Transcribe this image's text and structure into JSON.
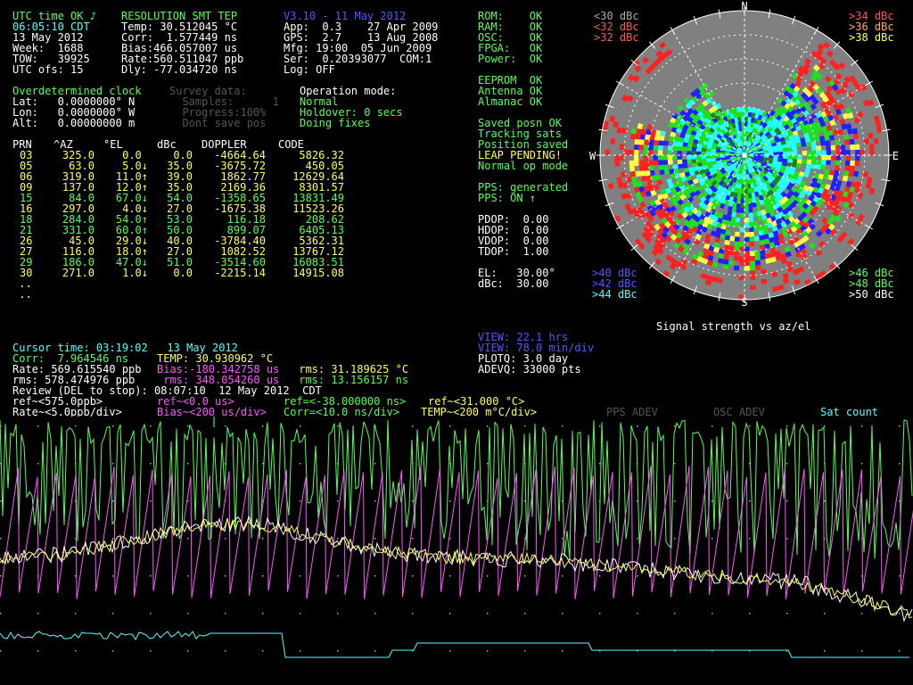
{
  "status": {
    "utc_line": "UTC time OK ♪",
    "receiver": "RESOLUTION SMT TEP",
    "version": "V3.10 - 11 May 2012",
    "time": "06:05:10 CDT",
    "date": "13 May 2012",
    "week": "Week:  1688",
    "tow": "TOW:   39925",
    "utc_ofs": "UTC ofs: 15",
    "temp": "Temp: 30.512045 °C",
    "corr": "Corr:  1.577449 ns",
    "bias": "Bias:466.057007 us",
    "rate": "Rate:560.511047 ppb",
    "dly": "Dly: -77.034720 ns",
    "app": "App:  0.3    27 Apr 2009",
    "gps": "GPS:  2.7    13 Aug 2008",
    "mfg": "Mfg: 19:00  05 Jun 2009",
    "ser": "Ser:  0.20393077  COM:1",
    "log": "Log: OFF"
  },
  "health": {
    "rom": "ROM:    OK",
    "ram": "RAM:    OK",
    "osc": "OSC:    OK",
    "fpga": "FPGA:   OK",
    "power": "Power:  OK",
    "eeprom": "EEPROM  OK",
    "antenna": "Antenna OK",
    "almanac": "Almanac OK",
    "saved_posn": "Saved posn OK",
    "tracking": "Tracking sats",
    "pos_saved": "Position saved",
    "leap": "LEAP PENDING!",
    "normal_op": "Normal op mode",
    "pps_gen": "PPS: generated",
    "pps_on": "PPS: ON ↑",
    "pdop": "PDOP:  0.00",
    "hdop": "HDOP:  0.00",
    "vdop": "VDOP:  0.00",
    "tdop": "TDOP:  1.00",
    "el": "EL:   30.00°",
    "dbc": "dBc:  30.00"
  },
  "position": {
    "header": "Overdetermined clock",
    "lat": "Lat:   0.0000000° N",
    "lon": "Lon:   0.0000000° W",
    "alt": "Alt:   0.00000000 m",
    "survey": "Survey data:",
    "samples": "  Samples:      1",
    "progress": "  Progress:100%",
    "dont_save": "  Dont save pos",
    "op_mode": "Operation mode:",
    "normal": "Normal",
    "holdover": "Holdover: 0 secs",
    "doing": "Doing fixes"
  },
  "sat_table": {
    "headers": [
      "PRN",
      "^AZ",
      "°EL",
      "dBc",
      "DOPPLER",
      "CODE"
    ],
    "rows": [
      {
        "prn": "03",
        "az": "325.0",
        "el": "0.0 ",
        "dbc": "0.0",
        "dop": "-4664.64",
        "code": "5826.32",
        "color": "y"
      },
      {
        "prn": "05",
        "az": "63.0",
        "el": "5.0↓",
        "dbc": "35.0",
        "dop": "-3675.72",
        "code": "450.05",
        "color": "y"
      },
      {
        "prn": "06",
        "az": "319.0",
        "el": "11.0↑",
        "dbc": "39.0",
        "dop": "1862.77",
        "code": "12629.64",
        "color": "y"
      },
      {
        "prn": "09",
        "az": "137.0",
        "el": "12.0↑",
        "dbc": "35.0",
        "dop": "2169.36",
        "code": "8301.57",
        "color": "y"
      },
      {
        "prn": "15",
        "az": "84.0",
        "el": "67.0↓",
        "dbc": "54.0",
        "dop": "-1358.65",
        "code": "13831.49",
        "color": "g"
      },
      {
        "prn": "16",
        "az": "297.0",
        "el": "4.0↓",
        "dbc": "27.0",
        "dop": "-1675.38",
        "code": "11523.26",
        "color": "y"
      },
      {
        "prn": "18",
        "az": "284.0",
        "el": "54.0↑",
        "dbc": "53.0",
        "dop": "116.18",
        "code": "208.62",
        "color": "g"
      },
      {
        "prn": "21",
        "az": "331.0",
        "el": "60.0↑",
        "dbc": "50.0",
        "dop": "899.07",
        "code": "6405.13",
        "color": "g"
      },
      {
        "prn": "26",
        "az": "45.0",
        "el": "29.0↓",
        "dbc": "40.0",
        "dop": "-3784.40",
        "code": "5362.31",
        "color": "y"
      },
      {
        "prn": "27",
        "az": "116.0",
        "el": "18.0↑",
        "dbc": "27.0",
        "dop": "1082.52",
        "code": "13767.12",
        "color": "y"
      },
      {
        "prn": "29",
        "az": "186.0",
        "el": "47.0↓",
        "dbc": "51.0",
        "dop": "-3514.60",
        "code": "16083.51",
        "color": "g"
      },
      {
        "prn": "30",
        "az": "271.0",
        "el": "1.0↓",
        "dbc": "0.0",
        "dop": "-2215.14",
        "code": "14915.08",
        "color": "y"
      }
    ],
    "dots1": " ..",
    "dots2": " .."
  },
  "map": {
    "north": "N",
    "south": "S",
    "east": "E",
    "west": "W",
    "legend_tl": [
      "<30 dBc",
      "<32 dBc",
      ">32 dBc"
    ],
    "legend_tr": [
      ">34 dBc",
      ">36 dBc",
      ">38 dBc"
    ],
    "legend_bl": [
      ">40 dBc",
      ">42 dBc",
      ">44 dBc"
    ],
    "legend_br": [
      ">46 dBc",
      ">48 dBc",
      ">50 dBc"
    ],
    "caption": "Signal strength vs az/el",
    "colors": {
      "gray": "#808080",
      "red": "#ff2020",
      "yellow": "#ffff40",
      "blue": "#2020ff",
      "green": "#20e020",
      "cyan": "#20ffff",
      "dgreen": "#208020"
    }
  },
  "plot_info": {
    "view_hrs": "VIEW: 22.1 hrs",
    "view_min": "VIEW: 78.0 min/div",
    "plotq": "PLOTQ: 3.0 day",
    "adevq": "ADEVQ: 33000 pts"
  },
  "cursor": {
    "cursor_time": "Cursor time: 03:19:02   13 May 2012",
    "corr_pre": "Corr:  7.964546 ns  ",
    "temp": "TEMP: 30.930962 °C",
    "rate": "Rate: 569.615540 ppb",
    "bias": "Bias:-180.342758 us",
    "rms_temp": " rms: 31.189625 °C",
    "rms_rate": "rms: 578.474976 ppb",
    "rms_bias": " rms: 348.054260 us",
    "rms_corr": " rms: 13.156157 ns",
    "review": "Review (DEL to stop): 08:07:10  12 May 2012  CDT",
    "ref_rate": "ref~<575.0ppb>",
    "ref_bias": "ref~<0.0 us>",
    "ref_corr": "ref=<-38.000000 ns>",
    "ref_temp": "ref~<31.000 °C>",
    "scale_rate": "Rate~<5.0ppb/div>",
    "scale_bias": "Bias~<200 us/div>",
    "scale_corr": "Corr=<10.0 ns/div>",
    "scale_temp": "TEMP~<200 m°C/div>",
    "pps_adev": "PPS ADEV",
    "osc_adev": "OSC ADEV",
    "sat_count": "Sat count"
  }
}
